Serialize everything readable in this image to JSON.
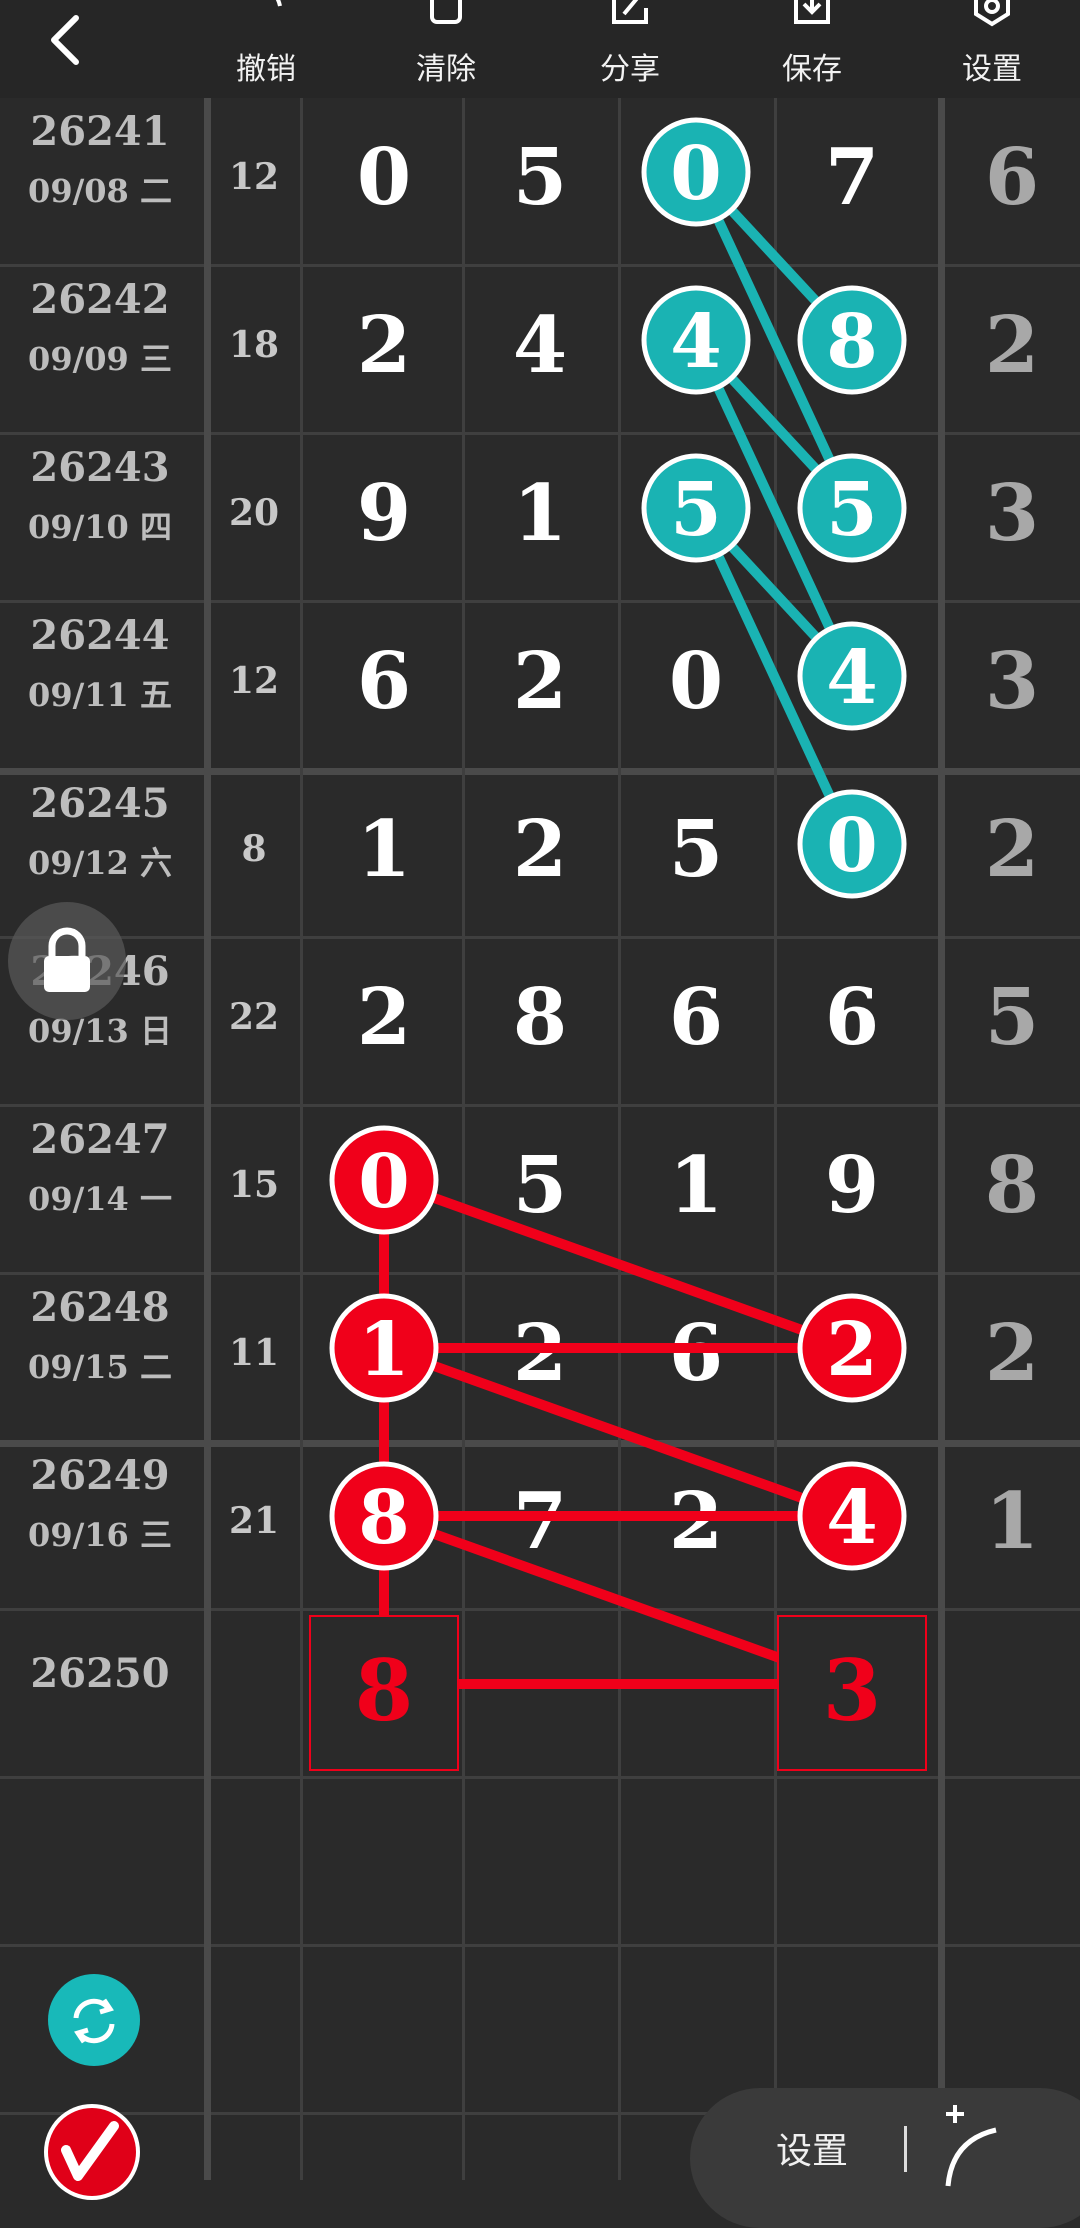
{
  "toolbar": {
    "back_label": "",
    "items": [
      {
        "label": "撤销",
        "icon": "undo-icon"
      },
      {
        "label": "清除",
        "icon": "trash-icon"
      },
      {
        "label": "分享",
        "icon": "share-icon"
      },
      {
        "label": "保存",
        "icon": "download-icon"
      },
      {
        "label": "设置",
        "icon": "gear-icon"
      }
    ]
  },
  "rows": [
    {
      "issue": "26241",
      "date": "09/08 二",
      "sum": "12",
      "digits": [
        "0",
        "5",
        "0",
        "7",
        "6"
      ]
    },
    {
      "issue": "26242",
      "date": "09/09 三",
      "sum": "18",
      "digits": [
        "2",
        "4",
        "4",
        "8",
        "2"
      ]
    },
    {
      "issue": "26243",
      "date": "09/10 四",
      "sum": "20",
      "digits": [
        "9",
        "1",
        "5",
        "5",
        "3"
      ]
    },
    {
      "issue": "26244",
      "date": "09/11 五",
      "sum": "12",
      "digits": [
        "6",
        "2",
        "0",
        "4",
        "3"
      ]
    },
    {
      "issue": "26245",
      "date": "09/12 六",
      "sum": "8",
      "digits": [
        "1",
        "2",
        "5",
        "0",
        "2"
      ]
    },
    {
      "issue": "26246",
      "date": "09/13 日",
      "sum": "22",
      "digits": [
        "2",
        "8",
        "6",
        "6",
        "5"
      ]
    },
    {
      "issue": "26247",
      "date": "09/14 一",
      "sum": "15",
      "digits": [
        "0",
        "5",
        "1",
        "9",
        "8"
      ]
    },
    {
      "issue": "26248",
      "date": "09/15 二",
      "sum": "11",
      "digits": [
        "1",
        "2",
        "6",
        "2",
        "2"
      ]
    },
    {
      "issue": "26249",
      "date": "09/16 三",
      "sum": "21",
      "digits": [
        "8",
        "7",
        "2",
        "4",
        "1"
      ]
    },
    {
      "issue": "26250",
      "date": "",
      "sum": "",
      "digits": [
        "8",
        "",
        "",
        "3",
        ""
      ]
    },
    {
      "issue": "",
      "date": "",
      "sum": "",
      "digits": [
        "",
        "",
        "",
        "",
        ""
      ]
    },
    {
      "issue": "",
      "date": "",
      "sum": "",
      "digits": [
        "",
        "",
        "",
        "",
        ""
      ]
    }
  ],
  "teal_circles": [
    {
      "row": 0,
      "col": 2,
      "label": "0"
    },
    {
      "row": 1,
      "col": 2,
      "label": "4"
    },
    {
      "row": 1,
      "col": 3,
      "label": "8"
    },
    {
      "row": 2,
      "col": 2,
      "label": "5"
    },
    {
      "row": 2,
      "col": 3,
      "label": "5"
    },
    {
      "row": 3,
      "col": 3,
      "label": "4"
    },
    {
      "row": 4,
      "col": 3,
      "label": "0"
    }
  ],
  "red_circles": [
    {
      "row": 6,
      "col": 0,
      "label": "0"
    },
    {
      "row": 7,
      "col": 0,
      "label": "1"
    },
    {
      "row": 7,
      "col": 3,
      "label": "2"
    },
    {
      "row": 8,
      "col": 0,
      "label": "8"
    },
    {
      "row": 8,
      "col": 3,
      "label": "4"
    }
  ],
  "red_boxes": [
    {
      "row": 9,
      "col": 0,
      "label": "8"
    },
    {
      "row": 9,
      "col": 3,
      "label": "3"
    }
  ],
  "bottom_menu": {
    "settings_label": "设置"
  },
  "colors": {
    "teal": "#1ab3b3",
    "red": "#f0001a",
    "background": "#2a2a2a"
  }
}
